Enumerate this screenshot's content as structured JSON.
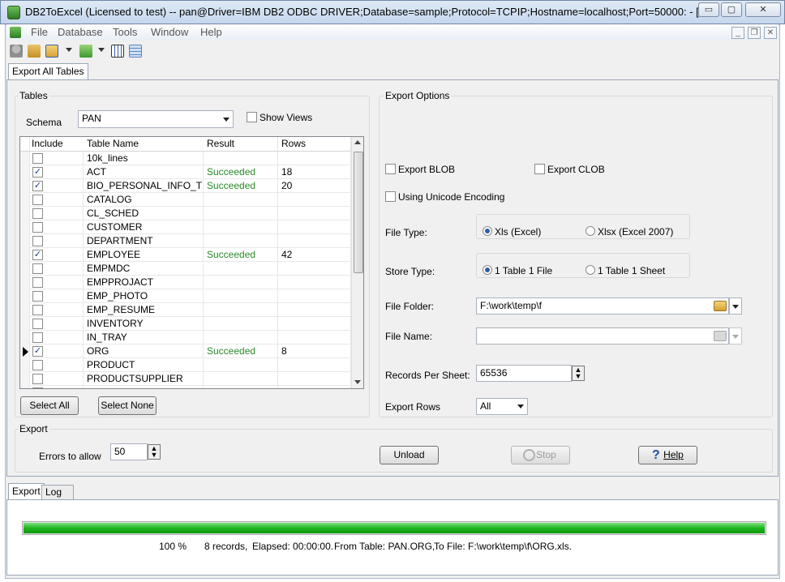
{
  "window": {
    "title": "DB2ToExcel (Licensed to test)  -- pan@Driver=IBM DB2 ODBC DRIVER;Database=sample;Protocol=TCPIP;Hostname=localhost;Port=50000: - [...",
    "min": "▭",
    "max": "▢",
    "close": "✕"
  },
  "menu": {
    "file": "File",
    "database": "Database",
    "tools": "Tools",
    "window": "Window",
    "help": "Help"
  },
  "mdi": {
    "min": "_",
    "restore": "❐",
    "close": "✕"
  },
  "tabs": {
    "export_all": "Export All Tables",
    "export": "Export",
    "log": "Log"
  },
  "tables": {
    "group_label": "Tables",
    "schema_label": "Schema",
    "schema_value": "PAN",
    "show_views": "Show Views",
    "columns": [
      "Include",
      "Table Name",
      "Result",
      "Rows"
    ],
    "rows": [
      {
        "checked": false,
        "name": "10k_lines",
        "result": "",
        "rows": ""
      },
      {
        "checked": true,
        "name": "ACT",
        "result": "Succeeded",
        "rows": "18"
      },
      {
        "checked": true,
        "name": "BIO_PERSONAL_INFO_T",
        "result": "Succeeded",
        "rows": "20"
      },
      {
        "checked": false,
        "name": "CATALOG",
        "result": "",
        "rows": ""
      },
      {
        "checked": false,
        "name": "CL_SCHED",
        "result": "",
        "rows": ""
      },
      {
        "checked": false,
        "name": "CUSTOMER",
        "result": "",
        "rows": ""
      },
      {
        "checked": false,
        "name": "DEPARTMENT",
        "result": "",
        "rows": ""
      },
      {
        "checked": true,
        "name": "EMPLOYEE",
        "result": "Succeeded",
        "rows": "42"
      },
      {
        "checked": false,
        "name": "EMPMDC",
        "result": "",
        "rows": ""
      },
      {
        "checked": false,
        "name": "EMPPROJACT",
        "result": "",
        "rows": ""
      },
      {
        "checked": false,
        "name": "EMP_PHOTO",
        "result": "",
        "rows": ""
      },
      {
        "checked": false,
        "name": "EMP_RESUME",
        "result": "",
        "rows": ""
      },
      {
        "checked": false,
        "name": "INVENTORY",
        "result": "",
        "rows": ""
      },
      {
        "checked": false,
        "name": "IN_TRAY",
        "result": "",
        "rows": ""
      },
      {
        "checked": true,
        "name": "ORG",
        "result": "Succeeded",
        "rows": "8",
        "current": true
      },
      {
        "checked": false,
        "name": "PRODUCT",
        "result": "",
        "rows": ""
      },
      {
        "checked": false,
        "name": "PRODUCTSUPPLIER",
        "result": "",
        "rows": ""
      },
      {
        "checked": false,
        "name": "PRODUCT...",
        "result": "",
        "rows": ""
      }
    ],
    "select_all": "Select All",
    "select_none": "Select None"
  },
  "options": {
    "group_label": "Export Options",
    "export_blob": "Export BLOB",
    "export_clob": "Export CLOB",
    "unicode": "Using Unicode Encoding",
    "file_type_label": "File Type:",
    "xls": "Xls (Excel)",
    "xlsx": "Xlsx (Excel 2007)",
    "store_type_label": "Store Type:",
    "store_file": "1 Table 1 File",
    "store_sheet": "1 Table 1 Sheet",
    "folder_label": "File Folder:",
    "folder_value": "F:\\work\\temp\\f",
    "name_label": "File Name:",
    "name_value": "",
    "records_label": "Records Per Sheet:",
    "records_value": "65536",
    "rows_label": "Export Rows",
    "rows_value": "All"
  },
  "export": {
    "group_label": "Export",
    "errors_label": "Errors to allow",
    "errors_value": "50",
    "unload": "Unload",
    "stop": "Stop",
    "help_prefix": "?",
    "help": "Help"
  },
  "status": {
    "progress": 1.0,
    "percent": "100 %",
    "records": "8 records,",
    "elapsed": "Elapsed: 00:00:00.",
    "from": "From Table: PAN.ORG,",
    "to": "To File: F:\\work\\temp\\f\\ORG.xls."
  },
  "colors": {
    "progress": "#1fb51f",
    "success": "#2a8a2a",
    "accent": "#2f5ea8"
  }
}
